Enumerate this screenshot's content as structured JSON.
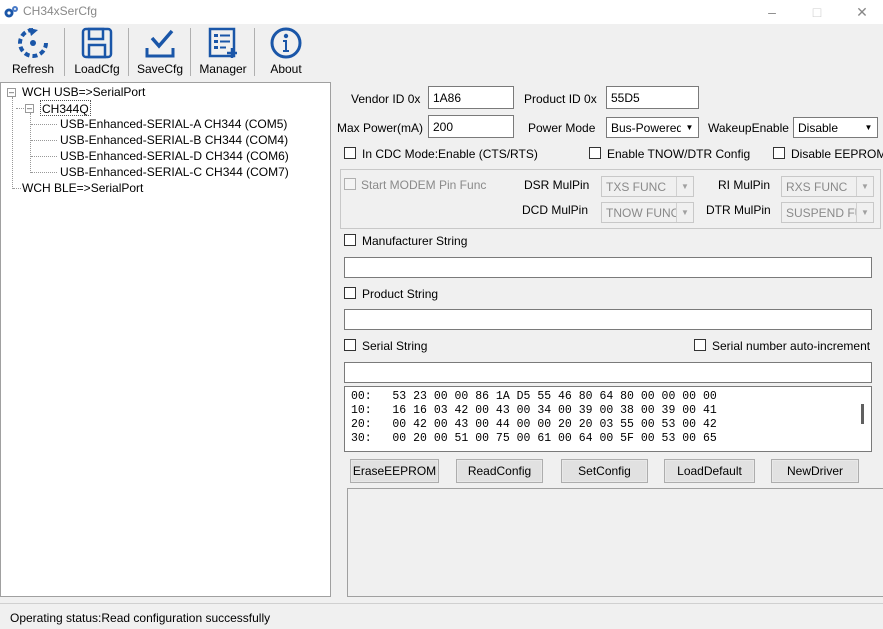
{
  "window": {
    "title": "CH34xSerCfg"
  },
  "toolbar": {
    "refresh": "Refresh",
    "load_cfg": "LoadCfg",
    "save_cfg": "SaveCfg",
    "manager": "Manager",
    "about": "About"
  },
  "tree": {
    "root_usb": "WCH USB=>SerialPort",
    "chip": "CH344Q",
    "ports": [
      "USB-Enhanced-SERIAL-A CH344 (COM5)",
      "USB-Enhanced-SERIAL-B CH344 (COM4)",
      "USB-Enhanced-SERIAL-D CH344 (COM6)",
      "USB-Enhanced-SERIAL-C CH344 (COM7)"
    ],
    "root_ble": "WCH BLE=>SerialPort"
  },
  "config": {
    "vendor_id_label": "Vendor ID 0x",
    "vendor_id": "1A86",
    "product_id_label": "Product ID 0x",
    "product_id": "55D5",
    "max_power_label": "Max Power(mA)",
    "max_power": "200",
    "power_mode_label": "Power Mode",
    "power_mode": "Bus-Powered",
    "wakeup_label": "WakeupEnable",
    "wakeup": "Disable",
    "cdc_mode_label": "In CDC Mode:Enable (CTS/RTS)",
    "tnow_dtr_label": "Enable TNOW/DTR Config",
    "disable_eeprom_label": "Disable EEPROM",
    "modem_label": "Start MODEM Pin Func",
    "dsr_label": "DSR MulPin",
    "dsr_value": "TXS FUNC",
    "ri_label": "RI MulPin",
    "ri_value": "RXS FUNC",
    "dcd_label": "DCD MulPin",
    "dcd_value": "TNOW FUNC",
    "dtr_label": "DTR MulPin",
    "dtr_value": "SUSPEND FUNC",
    "manufacturer_label": "Manufacturer String",
    "manufacturer_value": "",
    "product_label": "Product String",
    "product_value": "",
    "serial_label": "Serial String",
    "serial_auto_label": "Serial number auto-increment",
    "serial_value": ""
  },
  "hex": [
    "00:   53 23 00 00 86 1A D5 55 46 80 64 80 00 00 00 00",
    "10:   16 16 03 42 00 43 00 34 00 39 00 38 00 39 00 41",
    "20:   00 42 00 43 00 44 00 00 20 20 03 55 00 53 00 42",
    "30:   00 20 00 51 00 75 00 61 00 64 00 5F 00 53 00 65"
  ],
  "actions": {
    "erase": "EraseEEPROM",
    "read": "ReadConfig",
    "set": "SetConfig",
    "load_default": "LoadDefault",
    "new_driver": "NewDriver"
  },
  "status": {
    "text": "Operating status:Read configuration successfully"
  },
  "colors": {
    "icon_blue": "#1a56a8",
    "disabled_text": "#8a8a8a"
  }
}
